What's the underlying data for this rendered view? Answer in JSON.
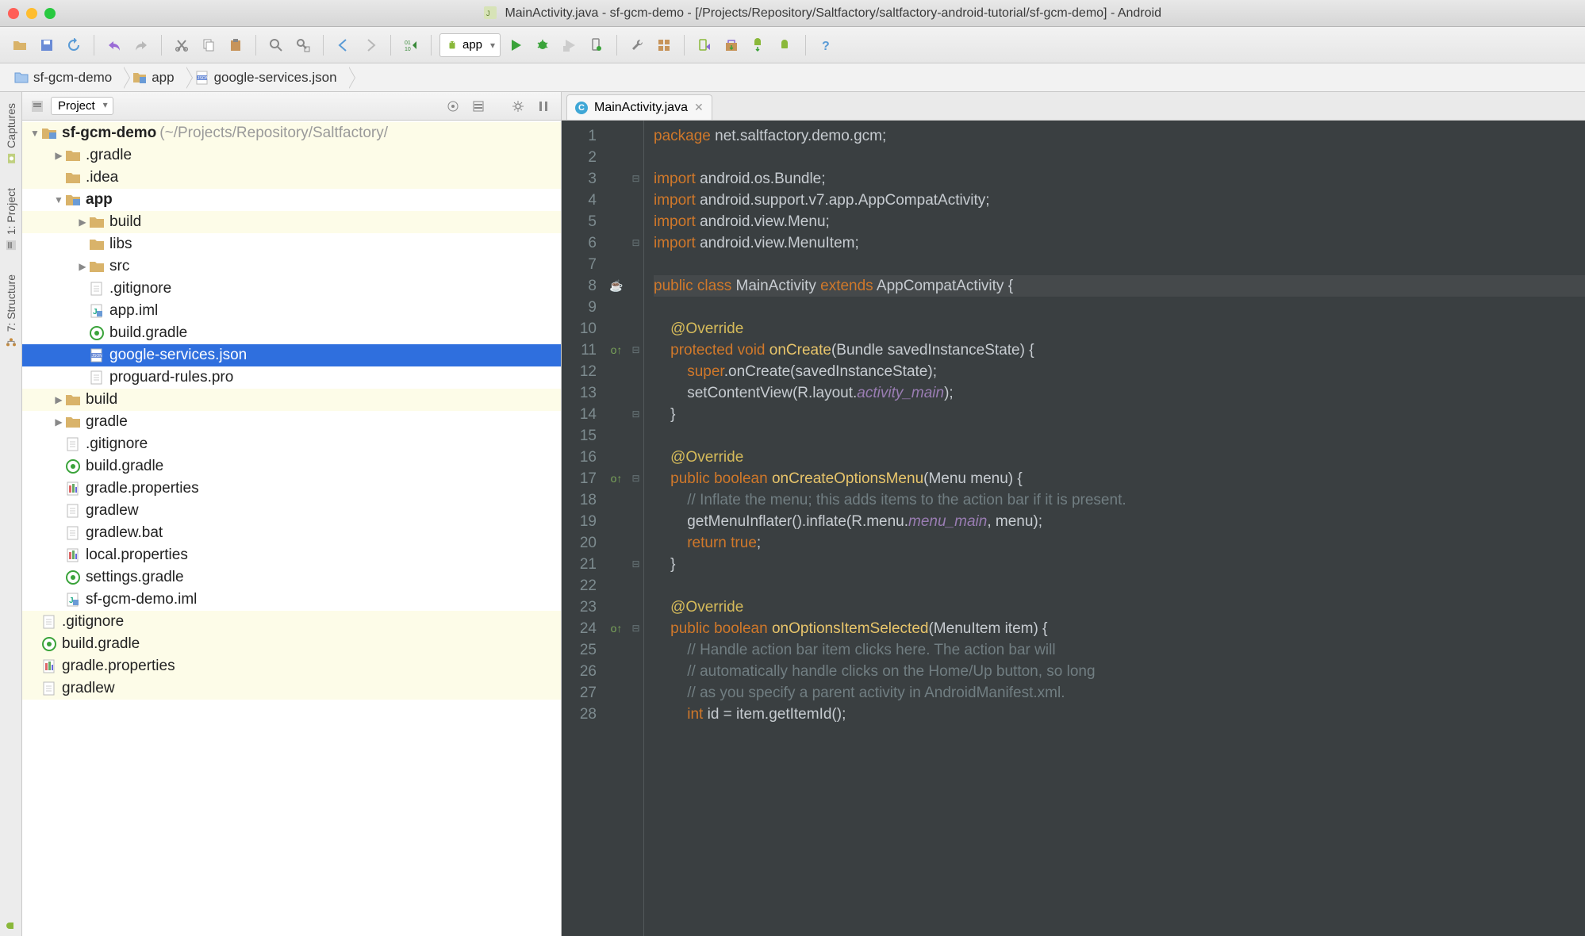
{
  "window": {
    "title": "MainActivity.java - sf-gcm-demo - [/Projects/Repository/Saltfactory/saltfactory-android-tutorial/sf-gcm-demo] - Android"
  },
  "toolbar": {
    "run_config": "app"
  },
  "breadcrumb": {
    "items": [
      {
        "icon": "folder",
        "label": "sf-gcm-demo"
      },
      {
        "icon": "module",
        "label": "app"
      },
      {
        "icon": "json",
        "label": "google-services.json"
      }
    ]
  },
  "sidebar_tabs": {
    "captures": "Captures",
    "project": "1: Project",
    "structure": "7: Structure"
  },
  "project_tool": {
    "view_label": "Project",
    "nodes": [
      {
        "d": 0,
        "tw": "down",
        "ico": "module",
        "label": "sf-gcm-demo",
        "hint": "(~/Projects/Repository/Saltfactory/",
        "bold": true,
        "bg": "y"
      },
      {
        "d": 1,
        "tw": "right",
        "ico": "folder",
        "label": ".gradle",
        "bg": "y"
      },
      {
        "d": 1,
        "tw": "",
        "ico": "folder",
        "label": ".idea",
        "bg": "y"
      },
      {
        "d": 1,
        "tw": "down",
        "ico": "module",
        "label": "app",
        "bold": true
      },
      {
        "d": 2,
        "tw": "right",
        "ico": "folder",
        "label": "build",
        "bg": "y"
      },
      {
        "d": 2,
        "tw": "",
        "ico": "folder",
        "label": "libs"
      },
      {
        "d": 2,
        "tw": "right",
        "ico": "folder",
        "label": "src"
      },
      {
        "d": 2,
        "tw": "",
        "ico": "file",
        "label": ".gitignore"
      },
      {
        "d": 2,
        "tw": "",
        "ico": "iml",
        "label": "app.iml"
      },
      {
        "d": 2,
        "tw": "",
        "ico": "gradle",
        "label": "build.gradle"
      },
      {
        "d": 2,
        "tw": "",
        "ico": "json",
        "label": "google-services.json",
        "sel": true
      },
      {
        "d": 2,
        "tw": "",
        "ico": "file",
        "label": "proguard-rules.pro"
      },
      {
        "d": 1,
        "tw": "right",
        "ico": "folder",
        "label": "build",
        "bg": "y"
      },
      {
        "d": 1,
        "tw": "right",
        "ico": "folder",
        "label": "gradle"
      },
      {
        "d": 1,
        "tw": "",
        "ico": "file",
        "label": ".gitignore"
      },
      {
        "d": 1,
        "tw": "",
        "ico": "gradle",
        "label": "build.gradle"
      },
      {
        "d": 1,
        "tw": "",
        "ico": "props",
        "label": "gradle.properties"
      },
      {
        "d": 1,
        "tw": "",
        "ico": "file",
        "label": "gradlew"
      },
      {
        "d": 1,
        "tw": "",
        "ico": "file",
        "label": "gradlew.bat"
      },
      {
        "d": 1,
        "tw": "",
        "ico": "props",
        "label": "local.properties"
      },
      {
        "d": 1,
        "tw": "",
        "ico": "gradle",
        "label": "settings.gradle"
      },
      {
        "d": 1,
        "tw": "",
        "ico": "iml",
        "label": "sf-gcm-demo.iml"
      },
      {
        "d": 0,
        "tw": "",
        "ico": "file",
        "label": ".gitignore",
        "bg": "y"
      },
      {
        "d": 0,
        "tw": "",
        "ico": "gradle",
        "label": "build.gradle",
        "bg": "y"
      },
      {
        "d": 0,
        "tw": "",
        "ico": "props",
        "label": "gradle.properties",
        "bg": "y"
      },
      {
        "d": 0,
        "tw": "",
        "ico": "file",
        "label": "gradlew",
        "bg": "y"
      }
    ]
  },
  "editor": {
    "tabs": [
      {
        "label": "MainActivity.java"
      }
    ],
    "lines": [
      {
        "n": 1,
        "html": "<span class='kw'>package</span> <span class='pkg'>net.saltfactory.demo.gcm;</span>"
      },
      {
        "n": 2,
        "html": ""
      },
      {
        "n": 3,
        "fold": "⊟",
        "html": "<span class='kw'>import</span> <span class='pkg'>android.os.Bundle;</span>"
      },
      {
        "n": 4,
        "html": "<span class='kw'>import</span> <span class='pkg'>android.support.v7.app.AppCompatActivity;</span>"
      },
      {
        "n": 5,
        "html": "<span class='kw'>import</span> <span class='pkg'>android.view.Menu;</span>"
      },
      {
        "n": 6,
        "fold": "⊟",
        "html": "<span class='kw'>import</span> <span class='pkg'>android.view.MenuItem;</span>"
      },
      {
        "n": 7,
        "html": ""
      },
      {
        "n": 8,
        "mark": "☕",
        "curr": true,
        "html": "<span class='kw'>public class</span> <span class='id'>MainActivity</span> <span class='kw'>extends</span> <span class='id'>AppCompatActivity</span> {"
      },
      {
        "n": 9,
        "html": ""
      },
      {
        "n": 10,
        "html": "    <span class='ann'>@Override</span>"
      },
      {
        "n": 11,
        "mark": "o↑",
        "fold": "⊟",
        "html": "    <span class='kw'>protected</span> <span class='kw'>void</span> <span class='fn'>onCreate</span>(Bundle savedInstanceState) {"
      },
      {
        "n": 12,
        "html": "        <span class='kw'>super</span>.onCreate(savedInstanceState);"
      },
      {
        "n": 13,
        "html": "        setContentView(R.layout.<span class='param-it'>activity_main</span>);"
      },
      {
        "n": 14,
        "fold": "⊟",
        "html": "    }"
      },
      {
        "n": 15,
        "html": ""
      },
      {
        "n": 16,
        "html": "    <span class='ann'>@Override</span>"
      },
      {
        "n": 17,
        "mark": "o↑",
        "fold": "⊟",
        "html": "    <span class='kw'>public</span> <span class='kw'>boolean</span> <span class='fn'>onCreateOptionsMenu</span>(Menu menu) {"
      },
      {
        "n": 18,
        "html": "        <span class='cmt'>// Inflate the menu; this adds items to the action bar if it is present.</span>"
      },
      {
        "n": 19,
        "html": "        getMenuInflater().inflate(R.menu.<span class='param-it'>menu_main</span>, menu);"
      },
      {
        "n": 20,
        "html": "        <span class='kw'>return</span> <span class='kw'>true</span>;"
      },
      {
        "n": 21,
        "fold": "⊟",
        "html": "    }"
      },
      {
        "n": 22,
        "html": ""
      },
      {
        "n": 23,
        "html": "    <span class='ann'>@Override</span>"
      },
      {
        "n": 24,
        "mark": "o↑",
        "fold": "⊟",
        "html": "    <span class='kw'>public</span> <span class='kw'>boolean</span> <span class='fn'>onOptionsItemSelected</span>(MenuItem item) {"
      },
      {
        "n": 25,
        "html": "        <span class='cmt'>// Handle action bar item clicks here. The action bar will</span>"
      },
      {
        "n": 26,
        "html": "        <span class='cmt'>// automatically handle clicks on the Home/Up button, so long</span>"
      },
      {
        "n": 27,
        "html": "        <span class='cmt'>// as you specify a parent activity in AndroidManifest.xml.</span>"
      },
      {
        "n": 28,
        "html": "        <span class='kw'>int</span> id = item.getItemId();"
      }
    ]
  }
}
